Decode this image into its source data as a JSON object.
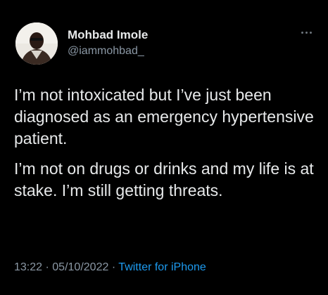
{
  "user": {
    "display_name": "Mohbad Imole",
    "handle": "@iammohbad_"
  },
  "icons": {
    "more": "more-horizontal-icon"
  },
  "tweet": {
    "paragraphs": [
      "I’m not intoxicated but I’ve just been diagnosed as an emergency hypertensive patient.",
      "I’m not on drugs or drinks and my life is at stake. I’m still getting threats."
    ],
    "time": "13:22",
    "date": "05/10/2022",
    "separator": "·",
    "source": "Twitter for iPhone"
  },
  "colors": {
    "background": "#000000",
    "text": "#e7e9ea",
    "secondary": "#8b98a5",
    "link": "#1d9bf0"
  }
}
